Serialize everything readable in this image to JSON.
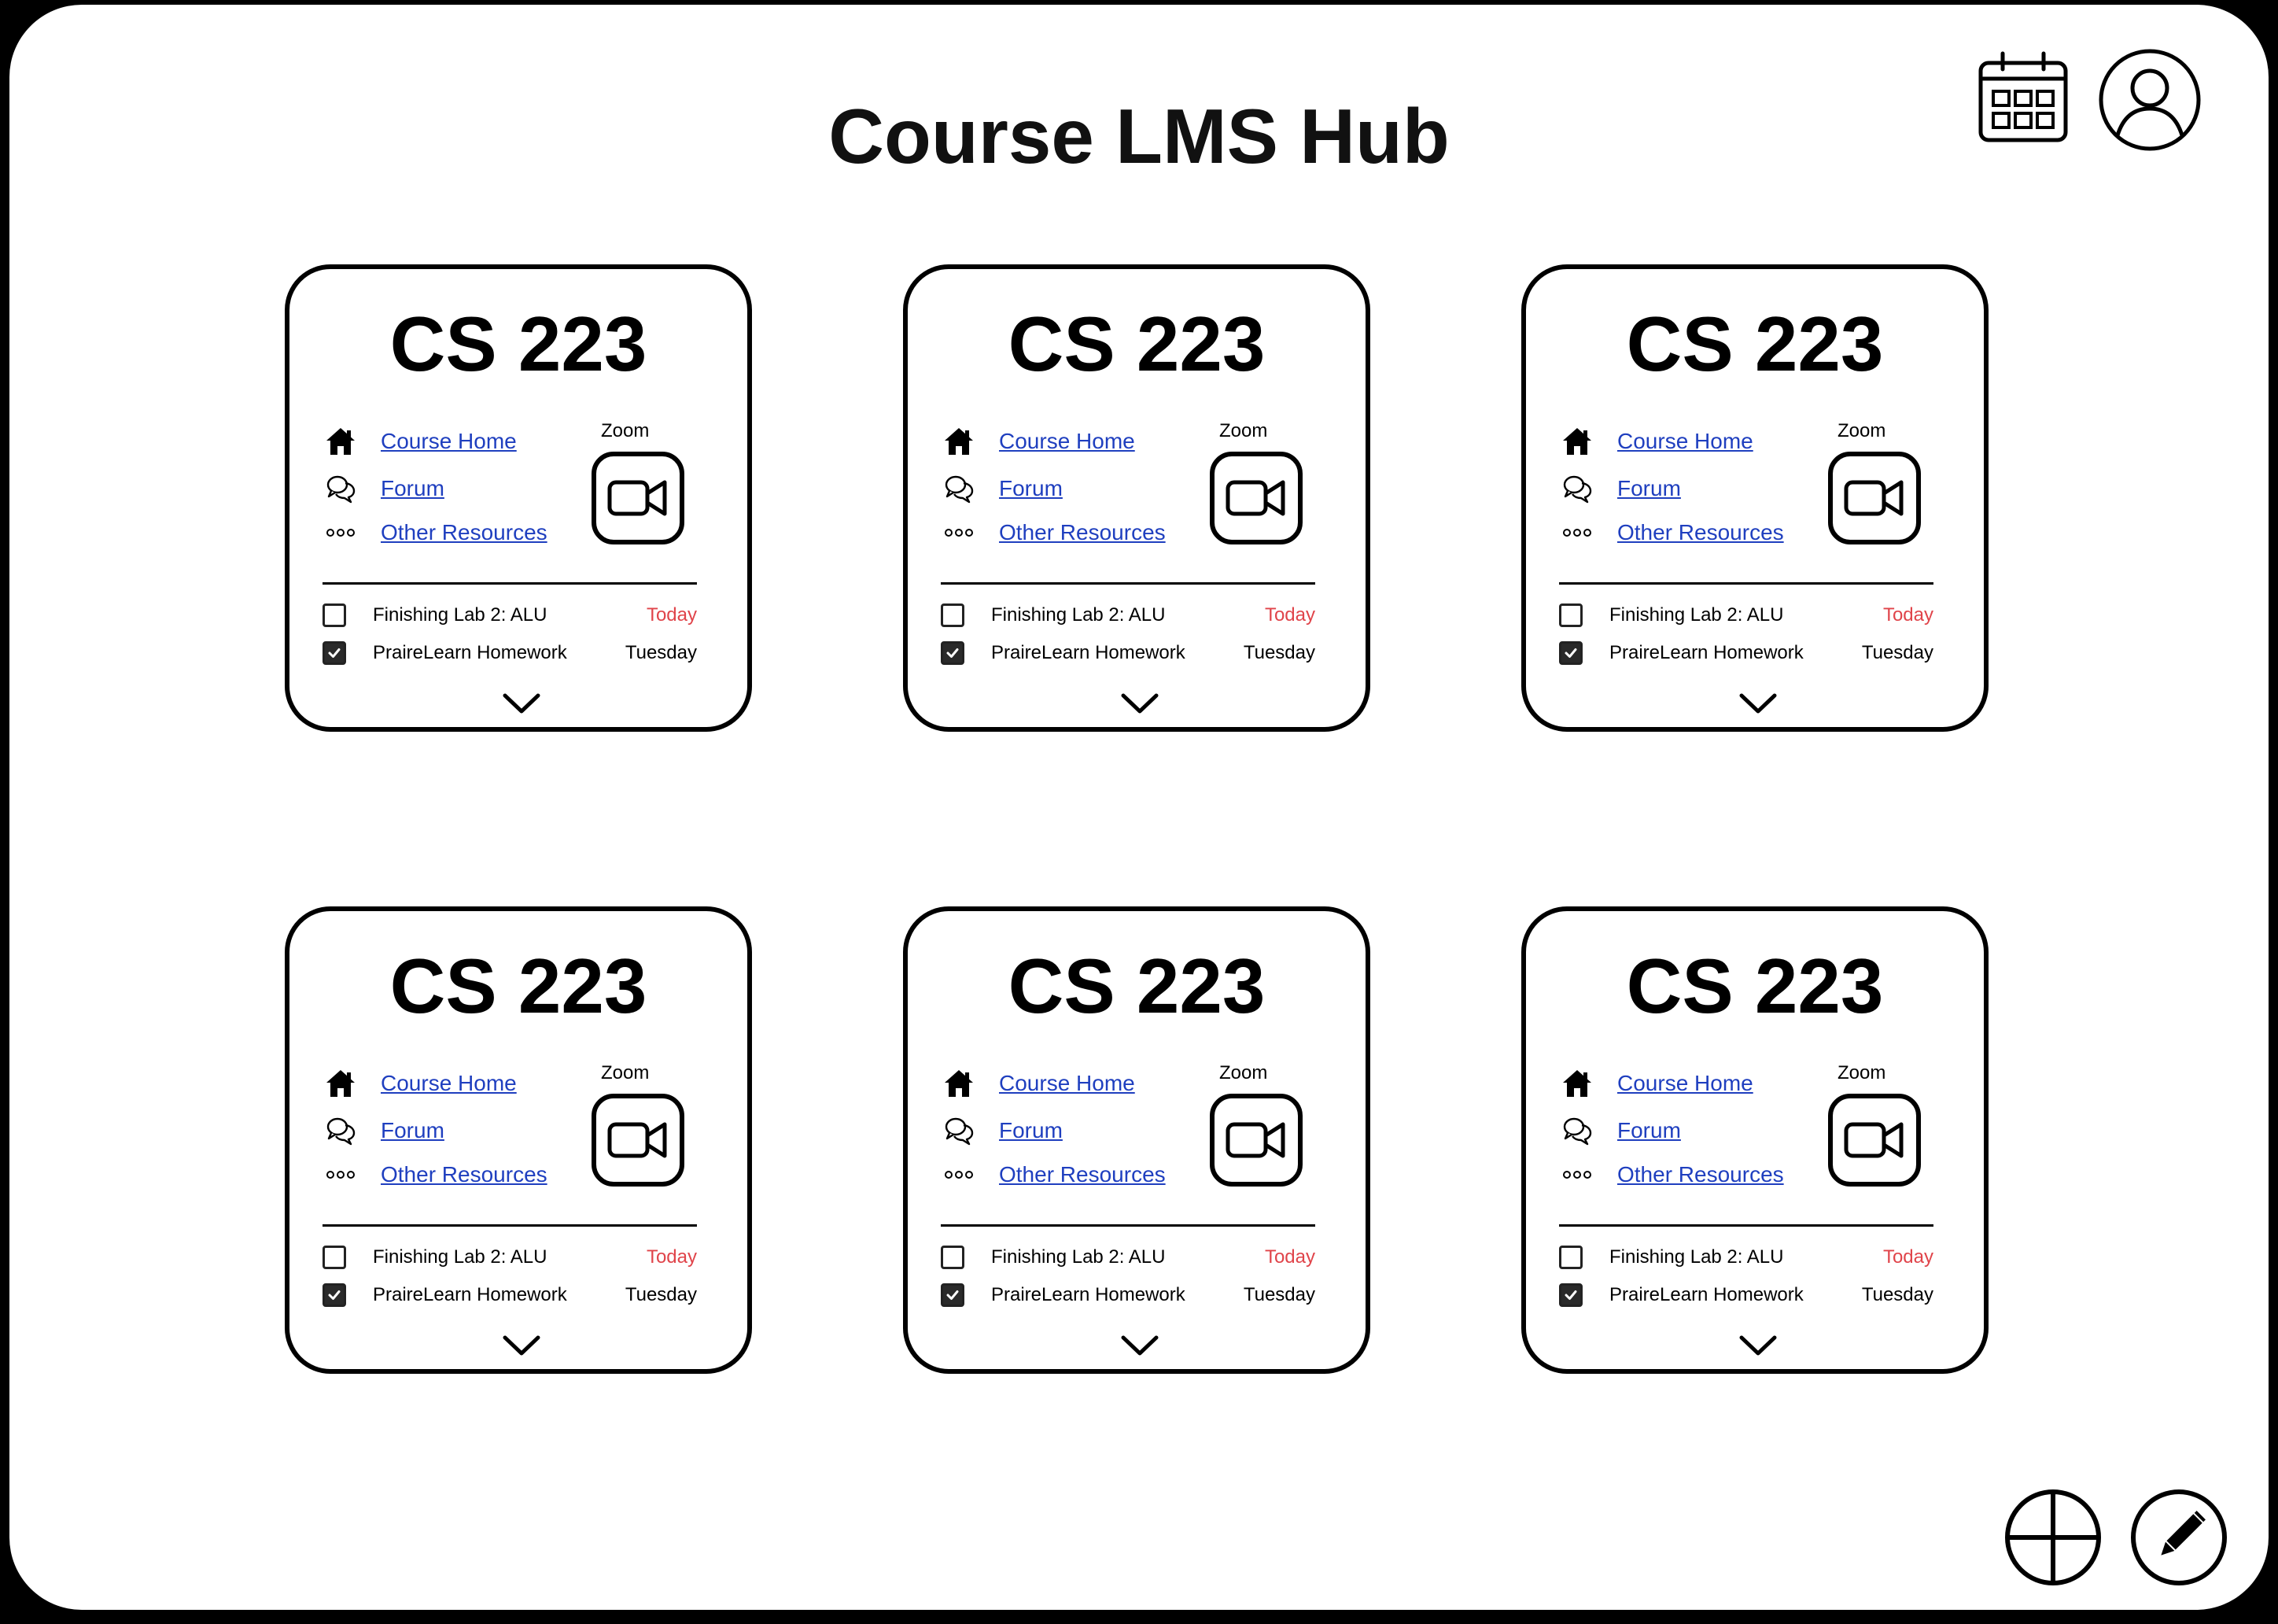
{
  "header": {
    "title": "Course LMS Hub"
  },
  "icons": {
    "calendar": "calendar-icon",
    "profile": "user-profile-icon",
    "add": "add-plus-icon",
    "edit": "edit-pencil-icon"
  },
  "colors": {
    "link": "#1f3fbf",
    "due_today": "#e0444a",
    "border": "#000000"
  },
  "cards": [
    {
      "title": "CS 223",
      "links": {
        "home": "Course Home",
        "forum": "Forum",
        "resources": "Other Resources"
      },
      "zoom_label": "Zoom",
      "tasks": [
        {
          "name": "Finishing Lab 2: ALU",
          "due": "Today",
          "checked": false
        },
        {
          "name": "PraireLearn Homework",
          "due": "Tuesday",
          "checked": true
        }
      ]
    },
    {
      "title": "CS 223",
      "links": {
        "home": "Course Home",
        "forum": "Forum",
        "resources": "Other Resources"
      },
      "zoom_label": "Zoom",
      "tasks": [
        {
          "name": "Finishing Lab 2: ALU",
          "due": "Today",
          "checked": false
        },
        {
          "name": "PraireLearn Homework",
          "due": "Tuesday",
          "checked": true
        }
      ]
    },
    {
      "title": "CS 223",
      "links": {
        "home": "Course Home",
        "forum": "Forum",
        "resources": "Other Resources"
      },
      "zoom_label": "Zoom",
      "tasks": [
        {
          "name": "Finishing Lab 2: ALU",
          "due": "Today",
          "checked": false
        },
        {
          "name": "PraireLearn Homework",
          "due": "Tuesday",
          "checked": true
        }
      ]
    },
    {
      "title": "CS 223",
      "links": {
        "home": "Course Home",
        "forum": "Forum",
        "resources": "Other Resources"
      },
      "zoom_label": "Zoom",
      "tasks": [
        {
          "name": "Finishing Lab 2: ALU",
          "due": "Today",
          "checked": false
        },
        {
          "name": "PraireLearn Homework",
          "due": "Tuesday",
          "checked": true
        }
      ]
    },
    {
      "title": "CS 223",
      "links": {
        "home": "Course Home",
        "forum": "Forum",
        "resources": "Other Resources"
      },
      "zoom_label": "Zoom",
      "tasks": [
        {
          "name": "Finishing Lab 2: ALU",
          "due": "Today",
          "checked": false
        },
        {
          "name": "PraireLearn Homework",
          "due": "Tuesday",
          "checked": true
        }
      ]
    },
    {
      "title": "CS 223",
      "links": {
        "home": "Course Home",
        "forum": "Forum",
        "resources": "Other Resources"
      },
      "zoom_label": "Zoom",
      "tasks": [
        {
          "name": "Finishing Lab 2: ALU",
          "due": "Today",
          "checked": false
        },
        {
          "name": "PraireLearn Homework",
          "due": "Tuesday",
          "checked": true
        }
      ]
    }
  ]
}
